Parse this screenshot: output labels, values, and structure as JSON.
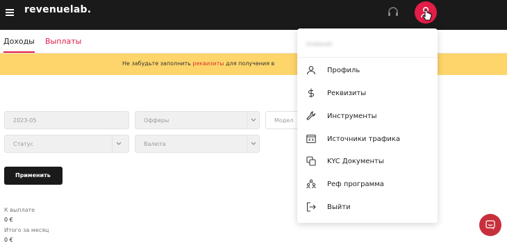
{
  "header": {
    "logo": "revenuelab.",
    "menu_icon": "hamburger-icon",
    "support_icon": "headset-icon",
    "profile_icon": "user-icon",
    "accent": "#e11d48",
    "background": "#1a1a1a"
  },
  "tabs": [
    {
      "label": "Доходы",
      "active": true
    },
    {
      "label": "Выплаты",
      "active": false
    }
  ],
  "banner": {
    "before": "Не забудьте заполнить ",
    "link": "реквизиты",
    "after": " для получения в",
    "background": "#fdd56a"
  },
  "filters": {
    "period": "2023-05",
    "offers": "Офферы",
    "model": "Модел",
    "status": "Статус",
    "currency": "Валюта"
  },
  "apply_label": "Применить",
  "stats": [
    {
      "label": "К выплате",
      "value": "0 €"
    },
    {
      "label": "Итого за месяц",
      "value": "0 €"
    }
  ],
  "dropdown": {
    "user": "Unakovel",
    "items": [
      {
        "label": "Профиль",
        "icon": "user-icon"
      },
      {
        "label": "Реквизиты",
        "icon": "dollar-icon"
      },
      {
        "label": "Инструменты",
        "icon": "wrench-icon"
      },
      {
        "label": "Источники трафика",
        "icon": "code-window-icon"
      },
      {
        "label": "KYC Документы",
        "icon": "copy-icon"
      },
      {
        "label": "Реф программа",
        "icon": "referral-icon"
      },
      {
        "label": "Выйти",
        "icon": "logout-icon"
      }
    ]
  },
  "chat_icon": "chat-icon"
}
